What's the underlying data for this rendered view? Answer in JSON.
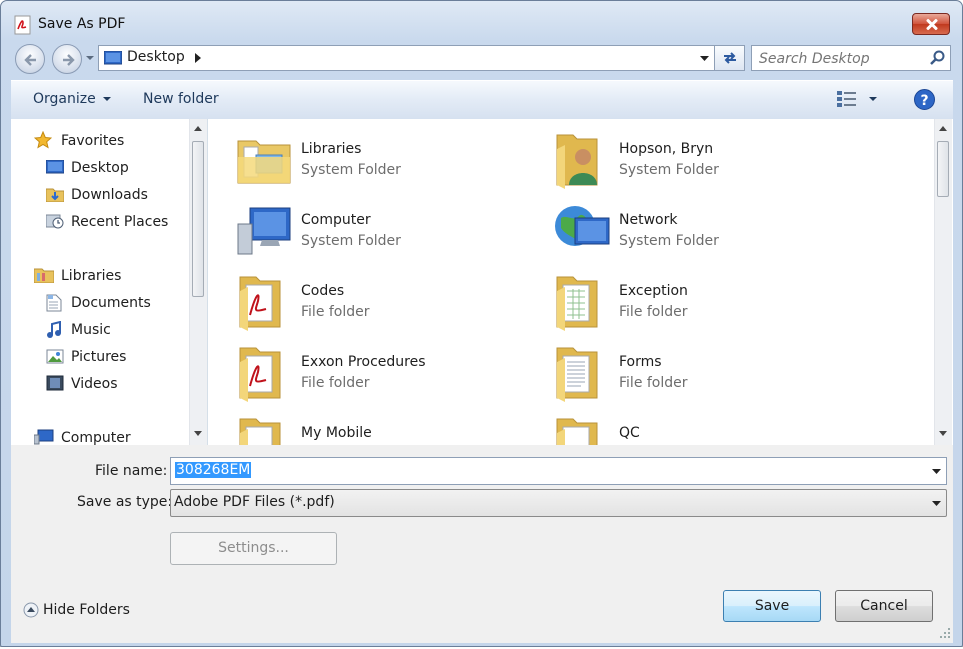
{
  "window": {
    "title": "Save As PDF"
  },
  "address": {
    "location": "Desktop"
  },
  "search": {
    "placeholder": "Search Desktop"
  },
  "toolbar": {
    "organize": "Organize",
    "new_folder": "New folder"
  },
  "nav": {
    "favorites": {
      "label": "Favorites",
      "items": [
        "Desktop",
        "Downloads",
        "Recent Places"
      ]
    },
    "libraries": {
      "label": "Libraries",
      "items": [
        "Documents",
        "Music",
        "Pictures",
        "Videos"
      ]
    },
    "computer": {
      "label": "Computer"
    }
  },
  "items": [
    {
      "name": "Libraries",
      "type": "System Folder",
      "icon": "libraries-folder-icon"
    },
    {
      "name": "Hopson, Bryn",
      "type": "System Folder",
      "icon": "user-folder-icon"
    },
    {
      "name": "Computer",
      "type": "System Folder",
      "icon": "computer-icon"
    },
    {
      "name": "Network",
      "type": "System Folder",
      "icon": "network-icon"
    },
    {
      "name": "Codes",
      "type": "File folder",
      "icon": "pdf-folder-icon"
    },
    {
      "name": "Exception",
      "type": "File folder",
      "icon": "excel-folder-icon"
    },
    {
      "name": "Exxon Procedures",
      "type": "File folder",
      "icon": "pdf-folder-icon"
    },
    {
      "name": "Forms",
      "type": "File folder",
      "icon": "document-folder-icon"
    },
    {
      "name": "My Mobile",
      "type": "",
      "icon": "folder-icon"
    },
    {
      "name": "QC",
      "type": "",
      "icon": "folder-icon"
    }
  ],
  "form": {
    "file_name_label": "File name:",
    "file_name_value": "308268EM",
    "save_as_type_label": "Save as type:",
    "save_as_type_value": "Adobe PDF Files (*.pdf)",
    "settings_label": "Settings...",
    "hide_folders_label": "Hide Folders",
    "save_label": "Save",
    "cancel_label": "Cancel"
  },
  "colors": {
    "selection": "#3399ff",
    "link_text": "#1e395b"
  }
}
